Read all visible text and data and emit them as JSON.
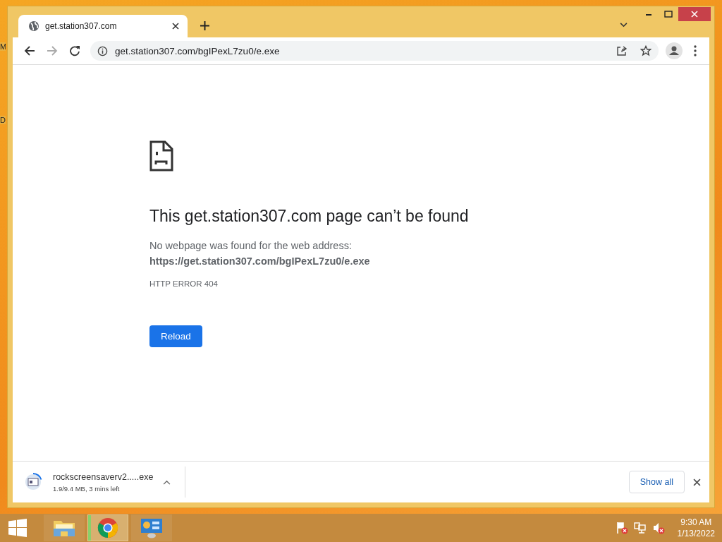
{
  "desktop_labels": [
    "M",
    "D"
  ],
  "browser": {
    "tabs": [
      {
        "title": "get.station307.com",
        "selected": true
      }
    ],
    "address": "get.station307.com/bgIPexL7zu0/e.exe"
  },
  "page": {
    "heading": "This get.station307.com page can’t be found",
    "message": "No webpage was found for the web address:",
    "url": "https://get.station307.com/bgIPexL7zu0/e.exe",
    "error_code": "HTTP ERROR 404",
    "button": "Reload"
  },
  "download": {
    "file": "rockscreensaverv2.....exe",
    "progress": "1.9/9.4 MB, 3 mins left",
    "level": 0.2,
    "show_all": "Show all"
  },
  "taskbar": {
    "apps": [
      {
        "kind": "explorer",
        "selected": false
      },
      {
        "kind": "chrome",
        "selected": true
      },
      {
        "kind": "control-panel",
        "selected": false
      }
    ],
    "time": "9:30 AM",
    "date": "1/13/2022"
  }
}
